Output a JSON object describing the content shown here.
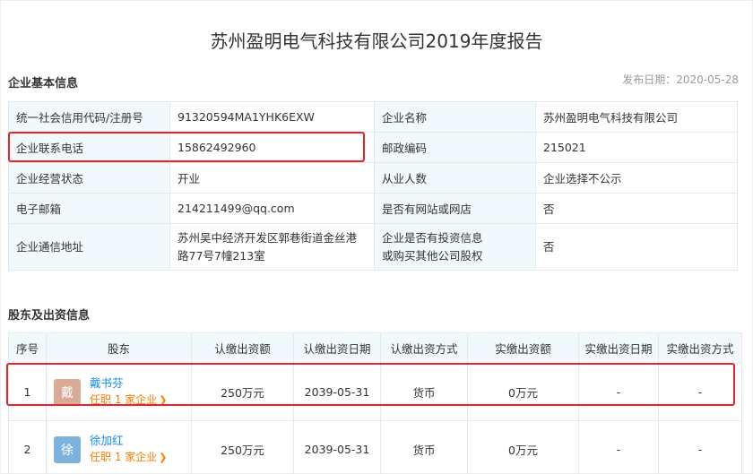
{
  "report": {
    "title": "苏州盈明电气科技有限公司2019年度报告",
    "publish_date": "发布日期：2020-05-28"
  },
  "basic": {
    "heading": "企业基本信息",
    "rows": [
      {
        "l1": "统一社会信用代码/注册号",
        "v1": "91320594MA1YHK6EXW",
        "l2": "企业名称",
        "v2": "苏州盈明电气科技有限公司"
      },
      {
        "l1": "企业联系电话",
        "v1": "15862492960",
        "l2": "邮政编码",
        "v2": "215021"
      },
      {
        "l1": "企业经营状态",
        "v1": "开业",
        "l2": "从业人数",
        "v2": "企业选择不公示"
      },
      {
        "l1": "电子邮箱",
        "v1": "214211499@qq.com",
        "l2": "是否有网站或网店",
        "v2": "否"
      },
      {
        "l1": "企业通信地址",
        "v1a": "苏州吴中经济开发区郭巷街道金丝港",
        "v1b": "路77号7幢213室",
        "l2a": "企业是否有投资信息",
        "l2b": "或购买其他公司股权",
        "v2": "否"
      }
    ]
  },
  "shareholders": {
    "heading": "股东及出资信息",
    "columns": [
      "序号",
      "股东",
      "认缴出资额",
      "认缴出资日期",
      "认缴出资方式",
      "实缴出资额",
      "实缴出资日期",
      "实缴出资方式"
    ],
    "rows": [
      {
        "no": "1",
        "avatar": "戴",
        "avatar_color": "#d7ab95",
        "name": "戴书芬",
        "job": "任职 1 家企业",
        "amount": "250万元",
        "date": "2039-05-31",
        "method": "货币",
        "paid": "0万元",
        "paid_date": "-",
        "paid_method": "-"
      },
      {
        "no": "2",
        "avatar": "徐",
        "avatar_color": "#7db2dc",
        "name": "徐加红",
        "job": "任职 1 家企业",
        "amount": "250万元",
        "date": "2039-05-31",
        "method": "货币",
        "paid": "0万元",
        "paid_date": "-",
        "paid_method": "-"
      }
    ]
  },
  "colors": {
    "highlight": "#e8232c",
    "label_bg": "#f2f9fc",
    "link": "#128bed",
    "job": "#ff7a00"
  }
}
